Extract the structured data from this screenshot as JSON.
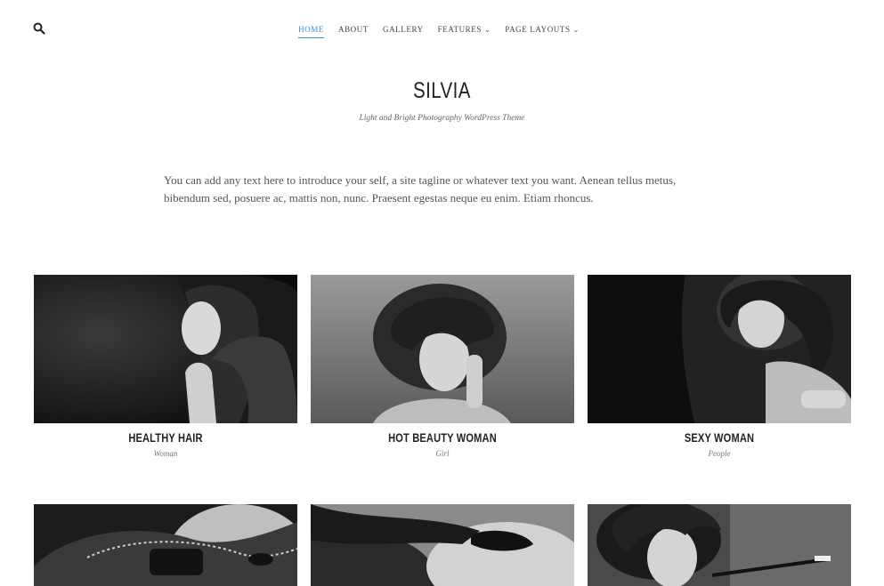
{
  "nav": {
    "items": [
      {
        "label": "HOME",
        "active": true,
        "dropdown": false
      },
      {
        "label": "ABOUT",
        "active": false,
        "dropdown": false
      },
      {
        "label": "GALLERY",
        "active": false,
        "dropdown": false
      },
      {
        "label": "FEATURES",
        "active": false,
        "dropdown": true
      },
      {
        "label": "PAGE LAYOUTS",
        "active": false,
        "dropdown": true
      }
    ],
    "search_icon": "search-icon",
    "accent_color": "#3b8fd1"
  },
  "site": {
    "title": "SILVIA",
    "tagline": "Light and Bright Photography WordPress Theme",
    "intro": "You can add any text here to introduce your self, a site tagline or whatever text you want. Aenean tellus metus, bibendum sed, posuere ac, mattis non, nunc. Praesent egestas neque eu enim. Etiam rhoncus."
  },
  "gallery": {
    "items": [
      {
        "title": "HEALTHY HAIR",
        "category": "Woman"
      },
      {
        "title": "HOT BEAUTY WOMAN",
        "category": "Girl"
      },
      {
        "title": "SEXY WOMAN",
        "category": "People"
      },
      {
        "title": "",
        "category": ""
      },
      {
        "title": "",
        "category": ""
      },
      {
        "title": "",
        "category": ""
      }
    ]
  }
}
